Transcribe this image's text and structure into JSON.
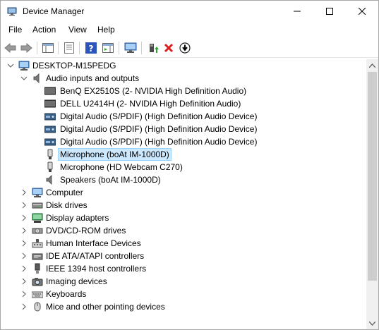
{
  "window": {
    "title": "Device Manager"
  },
  "menu": {
    "file": "File",
    "action": "Action",
    "view": "View",
    "help": "Help"
  },
  "tree": {
    "root": "DESKTOP-M15PEDG",
    "audio": {
      "label": "Audio inputs and outputs",
      "children": [
        "BenQ EX2510S (2- NVIDIA High Definition Audio)",
        "DELL U2414H (2- NVIDIA High Definition Audio)",
        "Digital Audio (S/PDIF) (High Definition Audio Device)",
        "Digital Audio (S/PDIF) (High Definition Audio Device)",
        "Digital Audio (S/PDIF) (High Definition Audio Device)",
        "Microphone (boAt IM-1000D)",
        "Microphone (HD Webcam C270)",
        "Speakers (boAt IM-1000D)"
      ]
    },
    "categories": [
      "Computer",
      "Disk drives",
      "Display adapters",
      "DVD/CD-ROM drives",
      "Human Interface Devices",
      "IDE ATA/ATAPI controllers",
      "IEEE 1394 host controllers",
      "Imaging devices",
      "Keyboards",
      "Mice and other pointing devices"
    ]
  }
}
